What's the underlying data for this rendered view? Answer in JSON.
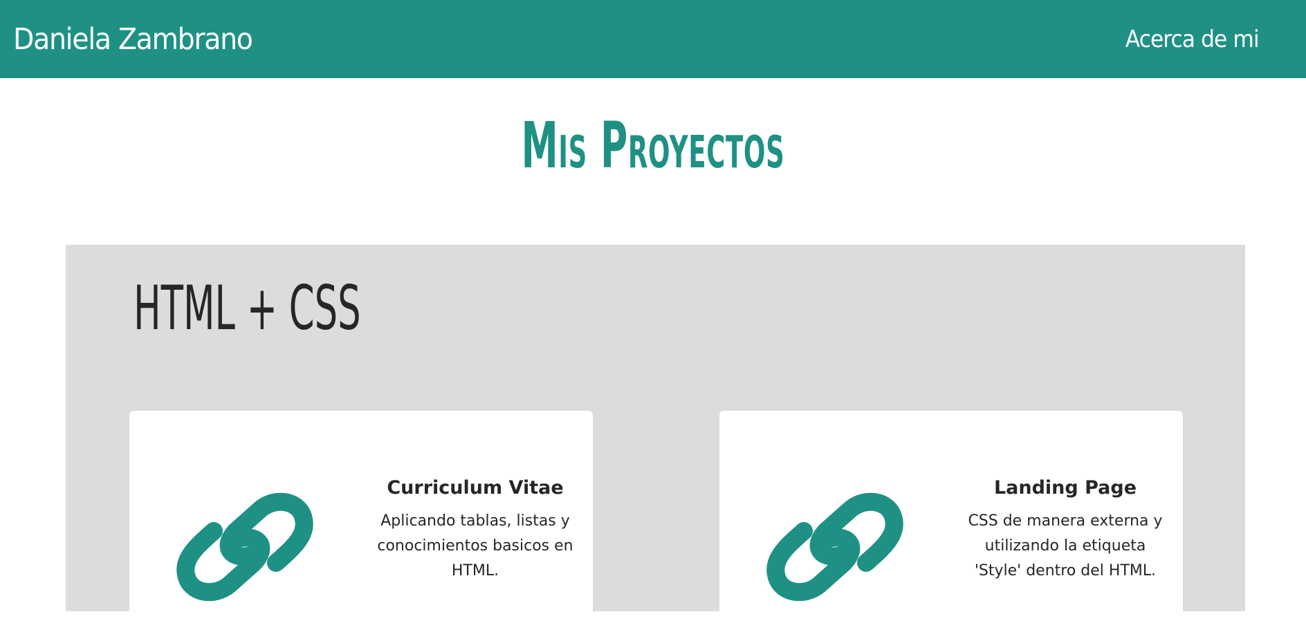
{
  "navbar": {
    "brand": "Daniela Zambrano",
    "link": "Acerca de mi"
  },
  "page": {
    "title": "Mis Proyectos"
  },
  "section": {
    "title": "HTML + CSS",
    "cards": [
      {
        "title": "Curriculum Vitae",
        "text": "Aplicando tablas, listas y conocimientos basicos en HTML.",
        "icon": "link-icon"
      },
      {
        "title": "Landing Page",
        "text": "CSS de manera externa y utilizando la etiqueta 'Style' dentro del HTML.",
        "icon": "link-icon"
      }
    ]
  },
  "colors": {
    "accent": "#1e9184",
    "section_bg": "#dcdcdc",
    "text": "#262626"
  }
}
